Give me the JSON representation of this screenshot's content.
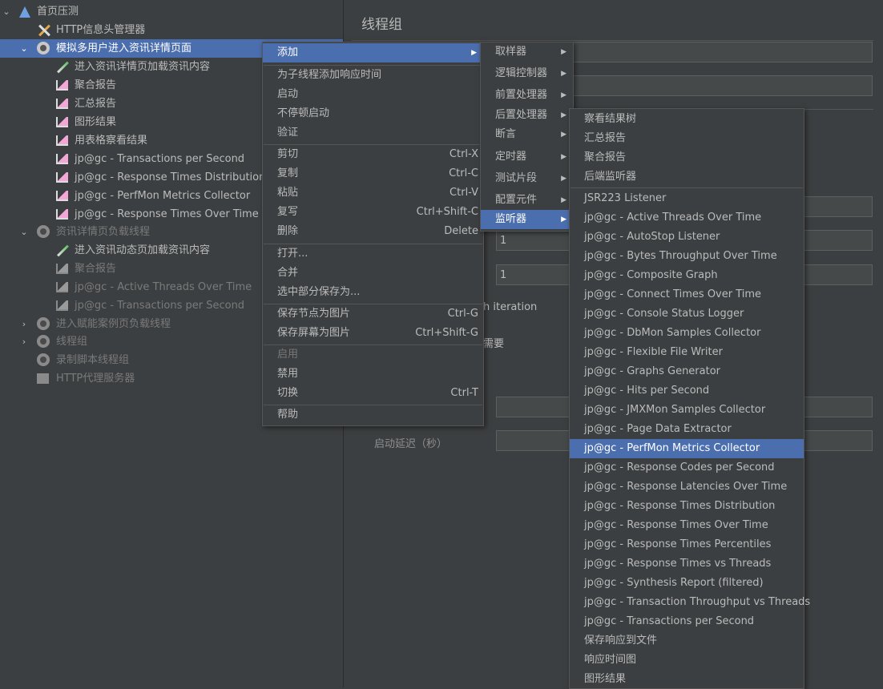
{
  "tree": [
    {
      "label": "首页压测",
      "icon": "flask-icon",
      "arrow": "expanded"
    },
    {
      "label": "HTTP信息头管理器",
      "icon": "tools-icon"
    },
    {
      "label": "模拟多用户进入资讯详情页面",
      "icon": "gear-icon",
      "arrow": "expanded"
    },
    {
      "label": "进入资讯详情页加载资讯内容",
      "icon": "pipette-icon"
    },
    {
      "label": "聚合报告",
      "icon": "chart-icon"
    },
    {
      "label": "汇总报告",
      "icon": "chart-icon"
    },
    {
      "label": "图形结果",
      "icon": "chart-icon"
    },
    {
      "label": "用表格察看结果",
      "icon": "chart-icon"
    },
    {
      "label": "jp@gc - Transactions per Second",
      "icon": "chart-icon"
    },
    {
      "label": "jp@gc - Response Times Distribution",
      "icon": "chart-icon"
    },
    {
      "label": "jp@gc - PerfMon Metrics Collector",
      "icon": "chart-icon"
    },
    {
      "label": "jp@gc - Response Times Over Time",
      "icon": "chart-icon"
    },
    {
      "label": "资讯详情页负载线程",
      "icon": "gear-icon",
      "arrow": "expanded"
    },
    {
      "label": "进入资讯动态页加载资讯内容",
      "icon": "pipette-icon"
    },
    {
      "label": "聚合报告",
      "icon": "chart-icon"
    },
    {
      "label": "jp@gc - Active Threads Over Time",
      "icon": "chart-icon"
    },
    {
      "label": "jp@gc - Transactions per Second",
      "icon": "chart-icon"
    },
    {
      "label": "进入赋能案例页负载线程",
      "icon": "gear-icon",
      "arrow": "collapsed"
    },
    {
      "label": "线程组",
      "icon": "gear-icon",
      "arrow": "collapsed"
    },
    {
      "label": "录制脚本线程组",
      "icon": "gear-icon"
    },
    {
      "label": "HTTP代理服务器",
      "icon": "proxy-icon"
    }
  ],
  "panel": {
    "title": "线程组",
    "field_value_1": "1",
    "field_value_2": "1",
    "iteration_text": "h iteration",
    "need_text": "需要",
    "delay_label": "启动延迟（秒）"
  },
  "menu1": [
    {
      "label": "添加",
      "submenu": true,
      "active": true
    },
    {
      "sep": true
    },
    {
      "label": "为子线程添加响应时间"
    },
    {
      "label": "启动"
    },
    {
      "label": "不停顿启动"
    },
    {
      "label": "验证"
    },
    {
      "sep": true
    },
    {
      "label": "剪切",
      "shortcut": "Ctrl-X"
    },
    {
      "label": "复制",
      "shortcut": "Ctrl-C"
    },
    {
      "label": "粘贴",
      "shortcut": "Ctrl-V"
    },
    {
      "label": "复写",
      "shortcut": "Ctrl+Shift-C"
    },
    {
      "label": "删除",
      "shortcut": "Delete"
    },
    {
      "sep": true
    },
    {
      "label": "打开..."
    },
    {
      "label": "合并"
    },
    {
      "label": "选中部分保存为..."
    },
    {
      "sep": true
    },
    {
      "label": "保存节点为图片",
      "shortcut": "Ctrl-G"
    },
    {
      "label": "保存屏幕为图片",
      "shortcut": "Ctrl+Shift-G"
    },
    {
      "sep": true
    },
    {
      "label": "启用",
      "disabled": true
    },
    {
      "label": "禁用"
    },
    {
      "label": "切换",
      "shortcut": "Ctrl-T"
    },
    {
      "sep": true
    },
    {
      "label": "帮助"
    }
  ],
  "menu2": [
    {
      "label": "取样器",
      "submenu": true
    },
    {
      "label": "逻辑控制器",
      "submenu": true
    },
    {
      "label": "前置处理器",
      "submenu": true
    },
    {
      "label": "后置处理器",
      "submenu": true
    },
    {
      "label": "断言",
      "submenu": true
    },
    {
      "label": "定时器",
      "submenu": true
    },
    {
      "label": "测试片段",
      "submenu": true
    },
    {
      "label": "配置元件",
      "submenu": true
    },
    {
      "label": "监听器",
      "submenu": true,
      "active": true
    }
  ],
  "menu3": [
    {
      "label": "察看结果树"
    },
    {
      "label": "汇总报告"
    },
    {
      "label": "聚合报告"
    },
    {
      "label": "后端监听器"
    },
    {
      "sep": true
    },
    {
      "label": "JSR223 Listener"
    },
    {
      "label": "jp@gc - Active Threads Over Time"
    },
    {
      "label": "jp@gc - AutoStop Listener"
    },
    {
      "label": "jp@gc - Bytes Throughput Over Time"
    },
    {
      "label": "jp@gc - Composite Graph"
    },
    {
      "label": "jp@gc - Connect Times Over Time"
    },
    {
      "label": "jp@gc - Console Status Logger"
    },
    {
      "label": "jp@gc - DbMon Samples Collector"
    },
    {
      "label": "jp@gc - Flexible File Writer"
    },
    {
      "label": "jp@gc - Graphs Generator"
    },
    {
      "label": "jp@gc - Hits per Second"
    },
    {
      "label": "jp@gc - JMXMon Samples Collector"
    },
    {
      "label": "jp@gc - Page Data Extractor"
    },
    {
      "label": "jp@gc - PerfMon Metrics Collector",
      "active": true
    },
    {
      "label": "jp@gc - Response Codes per Second"
    },
    {
      "label": "jp@gc - Response Latencies Over Time"
    },
    {
      "label": "jp@gc - Response Times Distribution"
    },
    {
      "label": "jp@gc - Response Times Over Time"
    },
    {
      "label": "jp@gc - Response Times Percentiles"
    },
    {
      "label": "jp@gc - Response Times vs Threads"
    },
    {
      "label": "jp@gc - Synthesis Report (filtered)"
    },
    {
      "label": "jp@gc - Transaction Throughput vs Threads"
    },
    {
      "label": "jp@gc - Transactions per Second"
    },
    {
      "label": "保存响应到文件"
    },
    {
      "label": "响应时间图"
    },
    {
      "label": "图形结果"
    }
  ],
  "colors": {
    "background": "#3c3f41",
    "selection": "#4b6eaf",
    "text": "#bbbbbb",
    "disabled": "#777777"
  }
}
